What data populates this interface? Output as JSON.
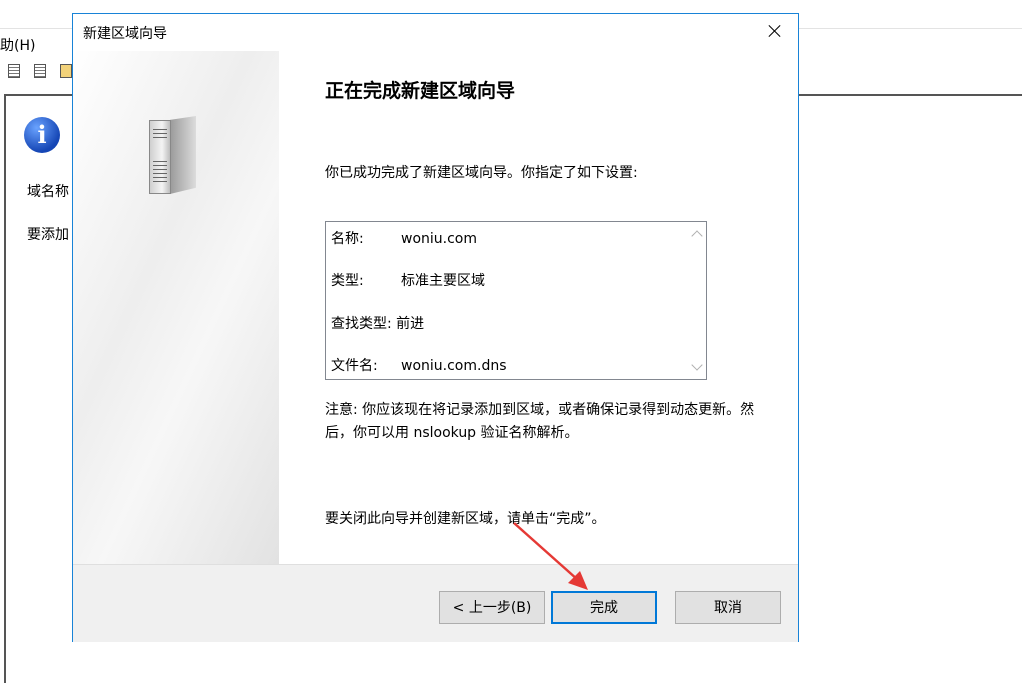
{
  "background_window": {
    "menu_help": "助(H)",
    "info_icon": "info-icon",
    "text_line1": "域名称",
    "text_line2": "要添加"
  },
  "dialog": {
    "title": "新建区域向导",
    "heading": "正在完成新建区域向导",
    "intro": "你已成功完成了新建区域向导。你指定了如下设置:",
    "settings": [
      {
        "label": "名称:",
        "value": "woniu.com"
      },
      {
        "label": "类型:",
        "value": "标准主要区域"
      },
      {
        "label": "查找类型:",
        "value": "前进"
      },
      {
        "label": "文件名:",
        "value": "woniu.com.dns"
      }
    ],
    "note": "注意: 你应该现在将记录添加到区域，或者确保记录得到动态更新。然后，你可以用 nslookup 验证名称解析。",
    "closing": "要关闭此向导并创建新区域，请单击“完成”。",
    "buttons": {
      "back": "< 上一步(B)",
      "finish": "完成",
      "cancel": "取消"
    }
  },
  "colors": {
    "accent": "#0078d7",
    "annotation_arrow": "#e53935"
  }
}
